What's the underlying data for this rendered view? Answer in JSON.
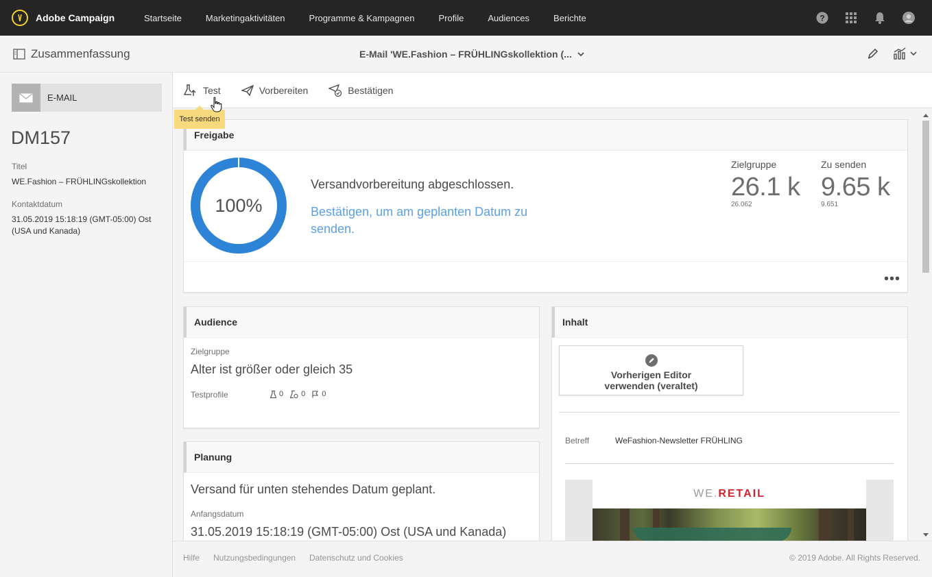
{
  "app": {
    "brand": "Adobe Campaign",
    "nav": [
      "Startseite",
      "Marketingaktivitäten",
      "Programme & Kampagnen",
      "Profile",
      "Audiences",
      "Berichte"
    ]
  },
  "subheader": {
    "summary_label": "Zusammenfassung",
    "document_title": "E-Mail 'WE.Fashion – FRÜHLINGskollektion (..."
  },
  "left": {
    "type_label": "E-MAIL",
    "delivery_id": "DM157",
    "title_label": "Titel",
    "title_value": "WE.Fashion – FRÜHLINGskollektion",
    "contact_label": "Kontaktdatum",
    "contact_value": "31.05.2019 15:18:19 (GMT-05:00) Ost (USA und Kanada)"
  },
  "toolbar": {
    "test": "Test",
    "prepare": "Vorbereiten",
    "confirm": "Bestätigen",
    "tooltip": "Test senden"
  },
  "approval": {
    "header": "Freigabe",
    "progress_text": "100%",
    "progress_value": 100,
    "status": "Versandvorbereitung abgeschlossen.",
    "confirm_link": "Bestätigen, um am geplanten Datum zu senden.",
    "target_label": "Zielgruppe",
    "target_value": "26.1 k",
    "target_exact": "26.062",
    "tosend_label": "Zu senden",
    "tosend_value": "9.65 k",
    "tosend_exact": "9.651"
  },
  "audience": {
    "header": "Audience",
    "target_label": "Zielgruppe",
    "target_value": "Alter ist größer oder gleich 35",
    "test_profiles_label": "Testprofile",
    "counts": [
      "0",
      "0",
      "0"
    ]
  },
  "planning": {
    "header": "Planung",
    "status": "Versand für unten stehendes Datum geplant.",
    "start_label": "Anfangsdatum",
    "start_value": "31.05.2019 15:18:19 (GMT-05:00) Ost (USA und Kanada)"
  },
  "content": {
    "header": "Inhalt",
    "legacy_editor": "Vorherigen Editor verwenden (veraltet)",
    "subject_label": "Betreff",
    "subject_value": "WeFashion-Newsletter FRÜHLING",
    "brand_prefix": "WE.",
    "brand_suffix": "RETAIL"
  },
  "footer": {
    "help": "Hilfe",
    "terms": "Nutzungsbedingungen",
    "privacy": "Datenschutz und Cookies",
    "copyright": "© 2019 Adobe. All Rights Reserved."
  },
  "colors": {
    "topbar": "#252525",
    "accent_blue": "#2d84d6",
    "link_blue": "#5ca1e6",
    "tooltip": "#f8d97e",
    "retail_red": "#d12430"
  }
}
